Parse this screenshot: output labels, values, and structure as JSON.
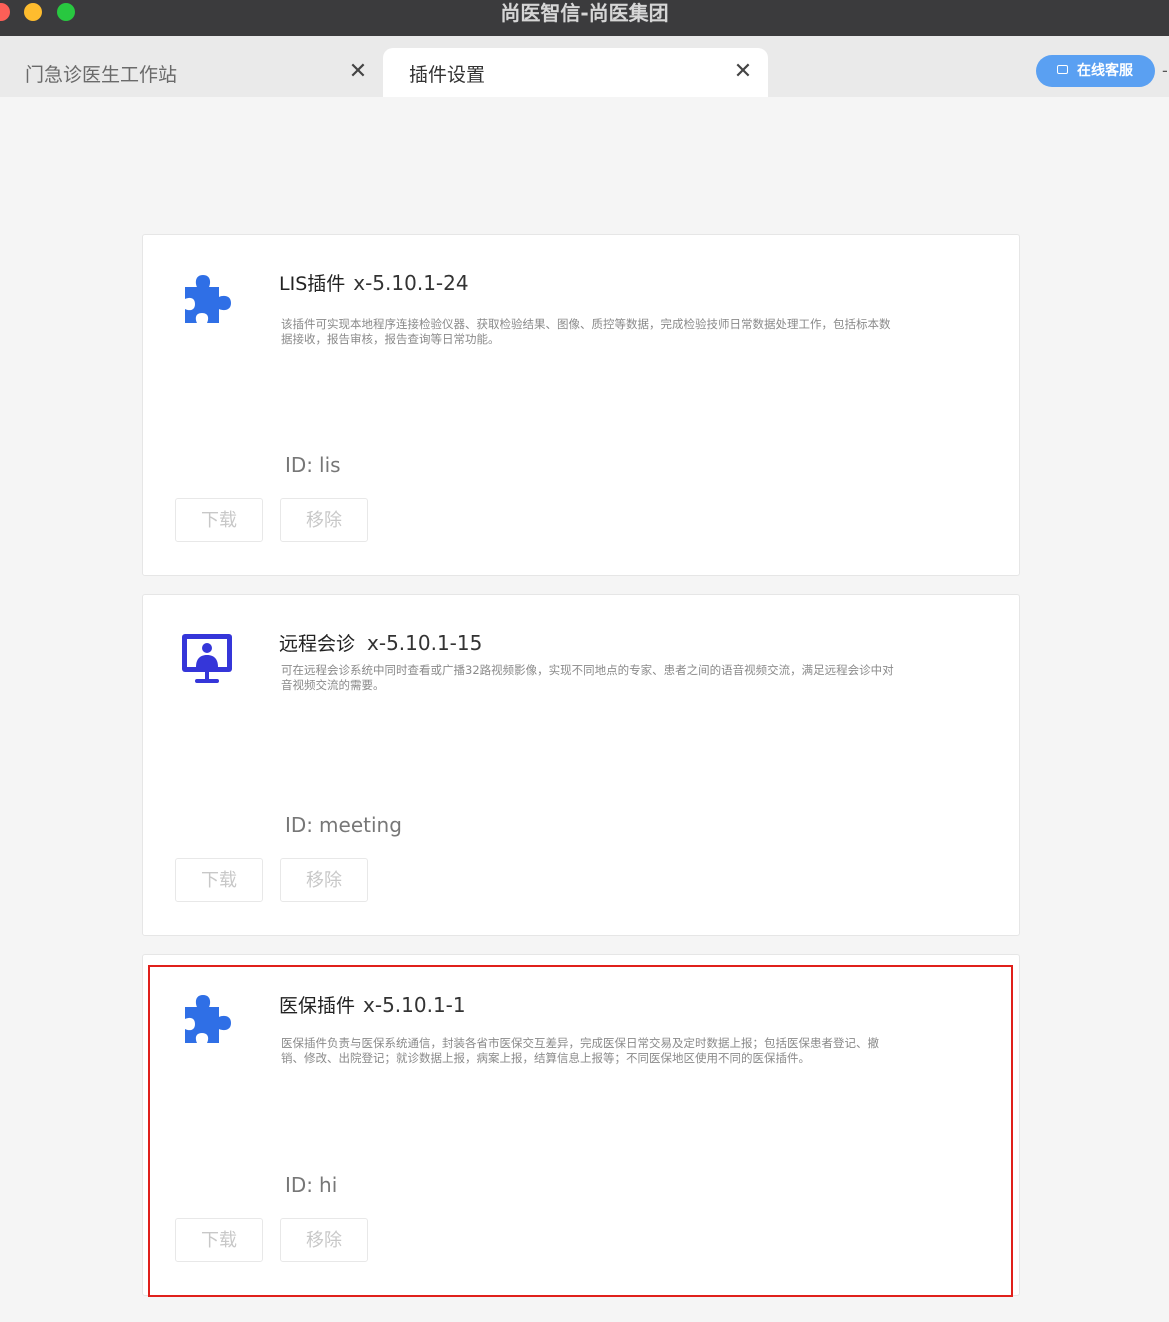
{
  "window": {
    "title": "尚医智信-尚医集团"
  },
  "tabs": [
    {
      "label": "门急诊医生工作站",
      "close": "✕"
    },
    {
      "label": "插件设置",
      "close": "✕"
    }
  ],
  "service": {
    "label": "在线客服",
    "icon": "chat-icon"
  },
  "header_mark": "-",
  "plugins": [
    {
      "name": "LIS插件",
      "version": "x-5.10.1-24",
      "description": "该插件可实现本地程序连接检验仪器、获取检验结果、图像、质控等数据，完成检验技师日常数据处理工作，包括标本数据接收，报告审核，报告查询等日常功能。",
      "id_label": "ID:",
      "id_value": "lis",
      "icon": "puzzle-icon",
      "download_label": "下载",
      "remove_label": "移除"
    },
    {
      "name": "远程会诊",
      "version": "x-5.10.1-15",
      "description": "可在远程会诊系统中同时查看或广播32路视频影像，实现不同地点的专家、患者之间的语音视频交流，满足远程会诊中对音视频交流的需要。",
      "id_label": "ID:",
      "id_value": "meeting",
      "icon": "monitor-doctor-icon",
      "download_label": "下载",
      "remove_label": "移除"
    },
    {
      "name": "医保插件",
      "version": "x-5.10.1-1",
      "description": "医保插件负责与医保系统通信，封装各省市医保交互差异，完成医保日常交易及定时数据上报；包括医保患者登记、撤销、修改、出院登记；就诊数据上报，病案上报，结算信息上报等；不同医保地区使用不同的医保插件。",
      "id_label": "ID:",
      "id_value": "hi",
      "icon": "puzzle-icon",
      "download_label": "下载",
      "remove_label": "移除"
    }
  ],
  "colors": {
    "icon_blue": "#2f6fe6",
    "monitor_blue": "#3536d9",
    "highlight_red": "#e0201b",
    "service_blue": "#5aa0f2"
  }
}
